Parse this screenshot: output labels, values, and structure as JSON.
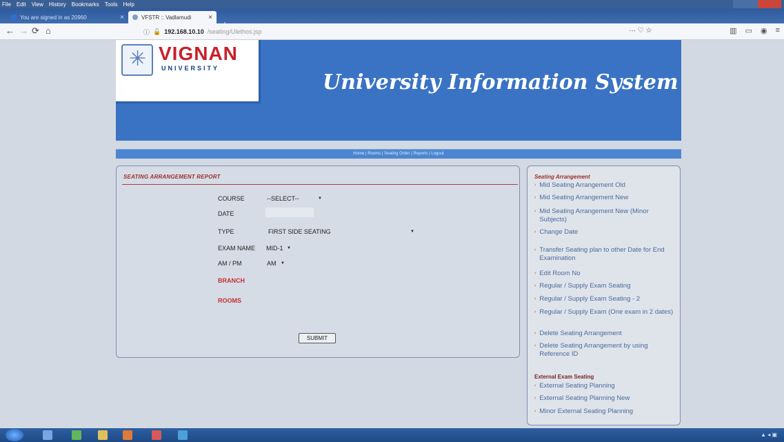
{
  "browser": {
    "menu": [
      "File",
      "Edit",
      "View",
      "History",
      "Bookmarks",
      "Tools",
      "Help"
    ],
    "tabs": [
      {
        "label": "You are signed in as 20960",
        "active": false
      },
      {
        "label": "VFSTR :: Vadlamudi",
        "active": true
      }
    ],
    "url_host": "192.168.10.10",
    "url_path": "/seating/Ulethos.jsp"
  },
  "header": {
    "brand": "VIGNAN",
    "brand_sub": "UNIVERSITY",
    "system_title": "University Information System",
    "nav_links": [
      "Home",
      "Rooms",
      "Seating Order",
      "Reports",
      "Logout"
    ]
  },
  "form": {
    "title": "SEATING ARRANGEMENT REPORT",
    "course_label": "COURSE",
    "course_value": "--SELECT--",
    "date_label": "DATE",
    "date_value": "",
    "type_label": "TYPE",
    "type_value": "FIRST SIDE SEATING",
    "exam_label": "EXAM NAME",
    "exam_value": "MID-1",
    "ampm_label": "AM / PM",
    "ampm_value": "AM",
    "branch_label": "BRANCH",
    "rooms_label": "ROOMS",
    "submit_label": "SUBMIT"
  },
  "side": {
    "heading1": "Seating Arrangement",
    "items1": [
      "Mid Seating Arrangement Old",
      "Mid Seating Arrangement New",
      "Mid Seating Arrangement New (Minor Subjects)",
      "Change Date",
      "Transfer Seating plan to other Date for End Examination",
      "Edit Room No",
      "Regular / Supply Exam Seating",
      "Regular / Supply Exam Seating - 2",
      "Regular / Supply Exam (One exam in 2 dates)",
      "Delete Seating Arrangement",
      "Delete Seating Arrangement by using Reference ID"
    ],
    "heading2": "External Exam Seating",
    "items2": [
      "External Seating Planning",
      "External Seating Planning New",
      "Minor External Seating Planning"
    ]
  },
  "colors": {
    "banner": "#3a73c4",
    "title_red": "#9b2d2d",
    "link_blue": "#4a6b9c"
  }
}
